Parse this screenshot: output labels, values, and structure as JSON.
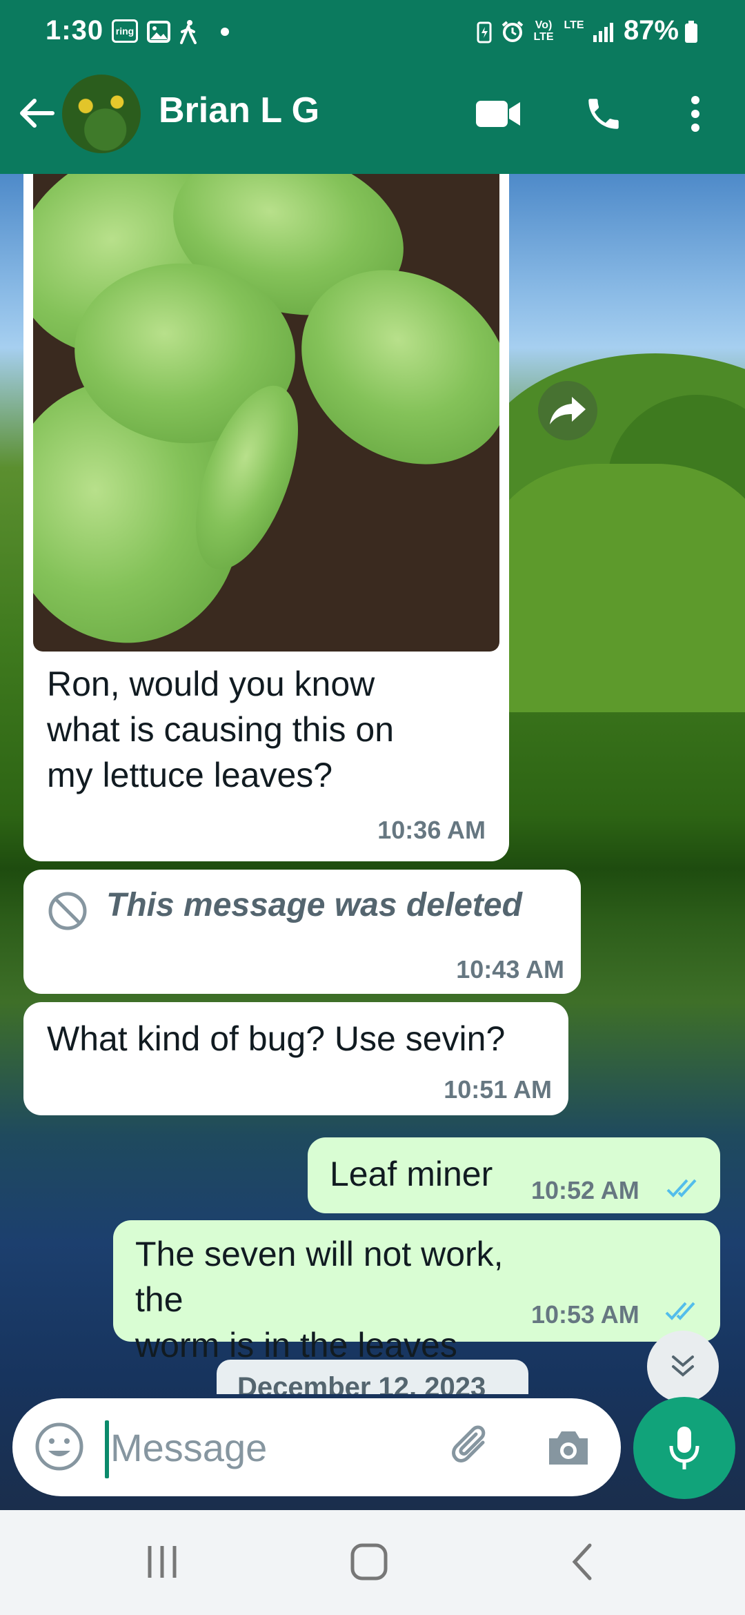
{
  "status_bar": {
    "time": "1:30",
    "ring_icon_label": "ring",
    "lte_top": "Vo) LTE",
    "lte_right": "LTE",
    "battery_percent": "87%"
  },
  "header": {
    "contact_name": "Brian L G",
    "icons": [
      "back-arrow-icon",
      "video-call-icon",
      "phone-call-icon",
      "more-options-icon"
    ],
    "color": "#0b7a5e"
  },
  "messages": [
    {
      "type": "image",
      "direction": "incoming",
      "image_description": "lettuce-leaves-photo",
      "text": "Ron, would you know what is causing this on my lettuce leaves?",
      "text_lines": [
        "Ron, would you know",
        "what is causing this on",
        "my lettuce leaves?"
      ],
      "time": "10:36 AM"
    },
    {
      "type": "deleted",
      "direction": "incoming",
      "text": "This message was deleted",
      "time": "10:43 AM"
    },
    {
      "type": "text",
      "direction": "incoming",
      "text": "What kind of bug? Use sevin?",
      "time": "10:51 AM"
    },
    {
      "type": "text",
      "direction": "outgoing",
      "text": "Leaf miner",
      "time": "10:52 AM",
      "status": "read"
    },
    {
      "type": "text",
      "direction": "outgoing",
      "text": "The seven will not work, the worm is in the leaves",
      "text_lines": [
        "The seven will not work, the",
        "worm is in the leaves"
      ],
      "time": "10:53 AM",
      "status": "read"
    }
  ],
  "date_chip": "December 12, 2023",
  "composer": {
    "placeholder": "Message",
    "value": ""
  },
  "colors": {
    "accent": "#11a37a",
    "outgoing_bubble": "#d9fdd3",
    "incoming_bubble": "#ffffff",
    "read_ticks": "#53bdeb"
  }
}
